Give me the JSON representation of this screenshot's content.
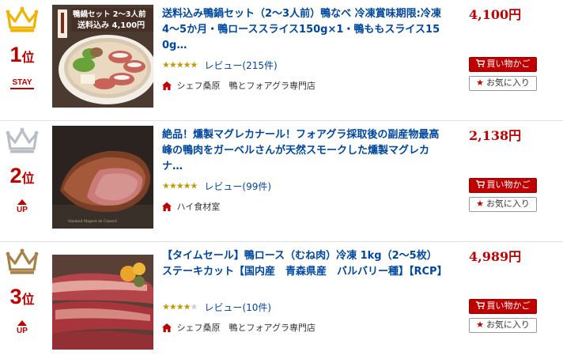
{
  "items": [
    {
      "rank": "1",
      "rank_suffix": "位",
      "trend": "STAY",
      "crown_color": "#f0b400",
      "thumb_text_line1": "鴨鍋セット 2〜3人前",
      "thumb_text_line2": "送料込み 4,100円",
      "title": "送料込み鴨鍋セット（2〜3人前）鴨なべ 冷凍賞味期限:冷凍4〜5か月・鴨ローススライス150g×1・鴨ももスライス150g…",
      "rating": 4.5,
      "stars_label": "★★★★★",
      "review_label": "レビュー",
      "review_count": "(215件)",
      "shop_name": "シェフ桑原　鴨とフォアグラ専門店",
      "price": "4,100円",
      "cart_label": "買い物かご",
      "fav_label": "お気に入り"
    },
    {
      "rank": "2",
      "rank_suffix": "位",
      "trend": "UP",
      "crown_color": "#b8bec6",
      "title": "絶品！燻製マグレカナール！フォアグラ採取後の副産物最高峰の鴨肉をガーベルさんが天然スモークした燻製マグレカナ…",
      "rating": 4.5,
      "stars_label": "★★★★★",
      "review_label": "レビュー",
      "review_count": "(99件)",
      "shop_name": "ハイ食材室",
      "price": "2,138円",
      "cart_label": "買い物かご",
      "fav_label": "お気に入り"
    },
    {
      "rank": "3",
      "rank_suffix": "位",
      "trend": "UP",
      "crown_color": "#a8804a",
      "title": "【タイムセール】鴨ロース（むね肉）冷凍 1kg（2〜5枚）ステーキカット【国内産　青森県産　バルバリー種】【RCP】",
      "rating": 4.0,
      "stars_on": "★★★★",
      "stars_off": "★",
      "review_label": "レビュー",
      "review_count": "(10件)",
      "shop_name": "シェフ桑原　鴨とフォアグラ専門店",
      "price": "4,989円",
      "cart_label": "買い物かご",
      "fav_label": "お気に入り"
    }
  ],
  "colors": {
    "accent": "#bf0000",
    "link": "#0047a0",
    "star": "#bf9b00"
  }
}
